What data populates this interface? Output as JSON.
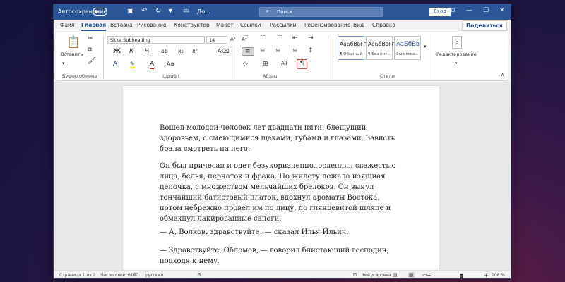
{
  "titlebar": {
    "autosave_label": "Автосохранение",
    "doc_name": "До...",
    "search_placeholder": "Поиск",
    "login_label": "Вход"
  },
  "tabs": [
    "Файл",
    "Главная",
    "Вставка",
    "Рисование",
    "Конструктор",
    "Макет",
    "Ссылки",
    "Рассылки",
    "Рецензирование",
    "Вид",
    "Справка"
  ],
  "share_label": "Поделиться",
  "ribbon": {
    "clipboard": {
      "paste_label": "Вставить",
      "group_label": "Буфер обмена"
    },
    "font": {
      "font_name": "Sitka Subheading",
      "font_size": "14",
      "group_label": "Шрифт",
      "bold": "Ж",
      "italic": "К",
      "underline": "Ч"
    },
    "paragraph": {
      "group_label": "Абзац",
      "pilcrow": "¶"
    },
    "styles": {
      "group_label": "Стили",
      "items": [
        {
          "sample": "АаБбВвГг",
          "name": "¶ Обычный"
        },
        {
          "sample": "АаБбВвГг",
          "name": "¶ Без инт..."
        },
        {
          "sample": "АаБбВв",
          "name": "Заголово..."
        }
      ]
    },
    "editing": {
      "label": "Редактирование"
    }
  },
  "document": {
    "paragraphs": [
      "Вошел молодой человек лет двадцати пяти, блещущий здоровьем, с смеющимися щеками, губами и глазами. Зависть брала смотреть на него.",
      "Он был причесан и одет безукоризненно, ослеплял свежестью лица, белья, перчаток и фрака. По жилету лежала изящная цепочка, с множеством мельчайших брелоков. Он вынул тончайший батистовый платок, вдохнул ароматы Востока, потом небрежно провел им по лицу, по глянцевитой шляпе и обмахнул лакированные сапоги.",
      "— А, Волков, здравствуйте! — сказал Илья Ильич.",
      "— Здравствуйте, Обломов, — говорил блистающий господин, подходя к нему."
    ]
  },
  "statusbar": {
    "page": "Страница 1 из 2",
    "words": "Число слов: 610",
    "lang": "русский",
    "focus": "Фокусировка",
    "zoom": "108 %"
  },
  "colors": {
    "accent": "#2b579a",
    "highlight": "#e0422e"
  }
}
